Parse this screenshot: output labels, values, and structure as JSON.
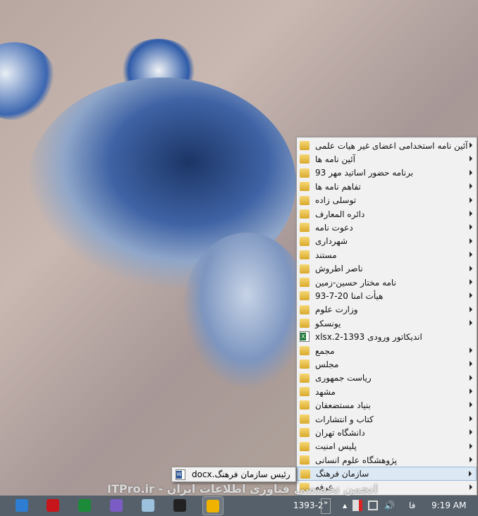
{
  "menu": {
    "items": [
      {
        "label": "آئین نامه استخدامی اعضای غیر هیات علمی",
        "icon": "folder-icon",
        "submenu": true
      },
      {
        "label": "آئین نامه ها",
        "icon": "folder-icon",
        "submenu": true
      },
      {
        "label": "برنامه حضور اساتید مهر 93",
        "icon": "folder-icon",
        "submenu": true
      },
      {
        "label": "تفاهم نامه ها",
        "icon": "folder-icon",
        "submenu": true
      },
      {
        "label": "توسلی زاده",
        "icon": "folder-icon",
        "submenu": true
      },
      {
        "label": "دائره المعارف",
        "icon": "folder-icon",
        "submenu": true
      },
      {
        "label": "دعوت نامه",
        "icon": "folder-icon",
        "submenu": true
      },
      {
        "label": "شهرداری",
        "icon": "folder-icon",
        "submenu": true
      },
      {
        "label": "مستند",
        "icon": "folder-icon",
        "submenu": true
      },
      {
        "label": "ناصر اطروش",
        "icon": "folder-icon",
        "submenu": true
      },
      {
        "label": "نامه مختار حسین-زمین",
        "icon": "folder-icon",
        "submenu": true
      },
      {
        "label": "هیأت امنا 20-7-93",
        "icon": "folder-icon",
        "submenu": true
      },
      {
        "label": "وزارت علوم",
        "icon": "folder-icon",
        "submenu": true
      },
      {
        "label": "یونسکو",
        "icon": "folder-icon",
        "submenu": true
      },
      {
        "label": "اندیکاتور ورودی 1393-2.xlsx",
        "icon": "excel-file-icon",
        "submenu": false
      },
      {
        "label": "مجمع",
        "icon": "folder-icon",
        "submenu": true
      },
      {
        "label": "مجلس",
        "icon": "folder-icon",
        "submenu": true
      },
      {
        "label": "ریاست جمهوری",
        "icon": "folder-icon",
        "submenu": true
      },
      {
        "label": "مشهد",
        "icon": "folder-icon",
        "submenu": true
      },
      {
        "label": "بنیاد مستضعفان",
        "icon": "folder-icon",
        "submenu": true
      },
      {
        "label": "کتاب و انتشارات",
        "icon": "folder-icon",
        "submenu": true
      },
      {
        "label": "دانشگاه تهران",
        "icon": "folder-icon",
        "submenu": true
      },
      {
        "label": "پلیس امنیت",
        "icon": "folder-icon",
        "submenu": true
      },
      {
        "label": "پژوهشگاه علوم انسانی",
        "icon": "folder-icon",
        "submenu": true
      },
      {
        "label": "سازمان فرهنگ",
        "icon": "folder-icon",
        "submenu": true,
        "highlighted": true
      },
      {
        "label": "عرفه",
        "icon": "folder-icon",
        "submenu": true
      }
    ]
  },
  "submenu": {
    "label": "رئیس سازمان فرهنگ.docx",
    "icon": "word-file-icon"
  },
  "watermark": "انجمن تخصصی فناوری اطلاعات ایران - ITPro.ir",
  "taskbar": {
    "apps": [
      {
        "name": "mail-icon",
        "color": "#2d7dd2"
      },
      {
        "name": "acrobat-icon",
        "color": "#c8151b"
      },
      {
        "name": "excel-icon",
        "color": "#1d8a3a"
      },
      {
        "name": "viber-icon",
        "color": "#7b5cc4"
      },
      {
        "name": "notepad-icon",
        "color": "#9cc1dc"
      },
      {
        "name": "cmd-icon",
        "color": "#222222"
      },
      {
        "name": "bing-icon",
        "color": "#f0b400",
        "active": true
      }
    ],
    "toolbar_label": "1393-2",
    "language": "فا",
    "clock": "9:19 AM"
  }
}
